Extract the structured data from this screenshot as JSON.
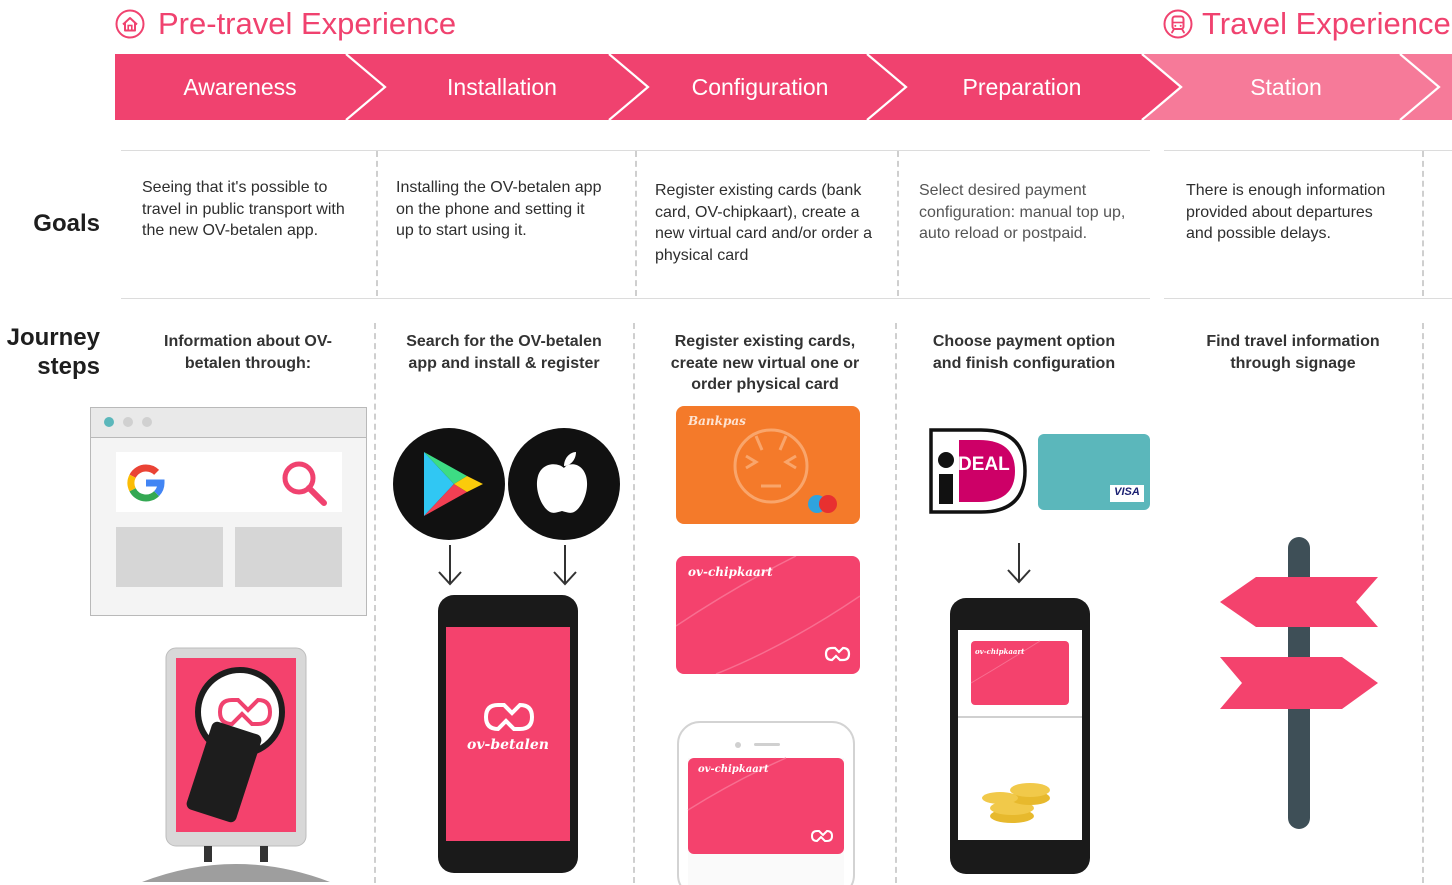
{
  "phases": {
    "pre_travel": "Pre-travel Experience",
    "travel": "Travel Experience"
  },
  "stages": [
    "Awareness",
    "Installation",
    "Configuration",
    "Preparation",
    "Station"
  ],
  "rows": {
    "goals": "Goals",
    "journey_line1": "Journey",
    "journey_line2": "steps"
  },
  "goals": [
    "Seeing that it's possible to travel in public transport with the new OV-betalen app.",
    "Installing the OV-betalen app on the phone and setting it up to start using it.",
    "Register existing cards (bank card, OV-chipkaart), create a new virtual card and/or order a physical card",
    "Select desired payment configuration: manual top up, auto reload or postpaid.",
    "There is enough information provided about departures and possible delays."
  ],
  "steps": [
    "Information about OV-betalen through:",
    "Search for the OV-betalen app and install & register",
    "Register existing cards, create new virtual one or order physical card",
    "Choose payment option and finish configuration",
    "Find travel information through signage"
  ],
  "cards": {
    "bankpas": "Bankpas",
    "chipkaart": "ov-chipkaart",
    "app_name": "ov-betalen",
    "ideal": "DEAL",
    "visa": "VISA"
  },
  "colors": {
    "accent": "#f0426f",
    "band": "#f0426f",
    "band_light": "#f67a99",
    "card_pink": "#f4426d",
    "bankpas_orange": "#f47a2a",
    "visa_teal": "#5bb7bb",
    "sign_post": "#3e4f57"
  },
  "icons": {
    "pre_travel": "house-icon",
    "travel": "train-icon",
    "search": "magnifier-icon",
    "google": "google-logo",
    "play": "google-play-logo",
    "apple": "apple-logo"
  }
}
